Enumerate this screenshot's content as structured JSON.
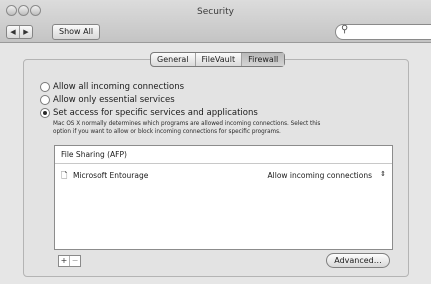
{
  "window": {
    "title": "Security",
    "show_all": "Show All",
    "search_placeholder": ""
  },
  "tabs": [
    "General",
    "FileVault",
    "Firewall"
  ],
  "firewall": {
    "options": [
      "Allow all incoming connections",
      "Allow only essential services",
      "Set access for specific services and applications"
    ],
    "description_line1": "Mac OS X normally determines which programs are allowed incoming connections. Select this",
    "description_line2": "option if you want to allow or block incoming connections for specific programs.",
    "list": {
      "row1": "File Sharing (AFP)",
      "row2_name": "Microsoft Entourage",
      "row2_access": "Allow incoming connections"
    },
    "add_label": "+",
    "remove_label": "−",
    "advanced_label": "Advanced…"
  }
}
